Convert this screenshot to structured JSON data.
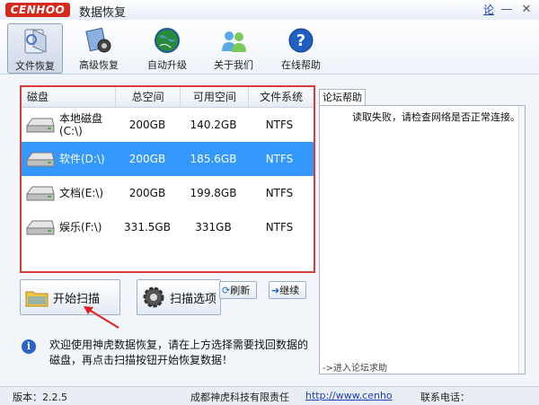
{
  "app": {
    "logo_text": "CENHOO",
    "title": "数据恢复",
    "help_link": "论"
  },
  "toolbar": {
    "items": [
      {
        "label": "文件恢复",
        "icon": "file-recovery-icon",
        "active": true
      },
      {
        "label": "高级恢复",
        "icon": "advanced-recovery-icon",
        "active": false
      },
      {
        "label": "自动升级",
        "icon": "globe-icon",
        "active": false
      },
      {
        "label": "关于我们",
        "icon": "about-users-icon",
        "active": false
      },
      {
        "label": "在线帮助",
        "icon": "help-icon",
        "active": false
      }
    ]
  },
  "drives": {
    "headers": [
      "磁盘",
      "总空间",
      "可用空间",
      "文件系统"
    ],
    "rows": [
      {
        "name": "本地磁盘 (C:\\)",
        "total": "200GB",
        "free": "140.2GB",
        "fs": "NTFS",
        "selected": false
      },
      {
        "name": "软件(D:\\)",
        "total": "200GB",
        "free": "185.6GB",
        "fs": "NTFS",
        "selected": true
      },
      {
        "name": "文档(E:\\)",
        "total": "200GB",
        "free": "199.8GB",
        "fs": "NTFS",
        "selected": false
      },
      {
        "name": "娱乐(F:\\)",
        "total": "331.5GB",
        "free": "331GB",
        "fs": "NTFS",
        "selected": false
      }
    ]
  },
  "actions": {
    "scan": "开始扫描",
    "options": "扫描选项",
    "refresh": "刷新",
    "continue": "继续"
  },
  "info": {
    "text": "欢迎使用神虎数据恢复，请在上方选择需要找回数据的磁盘，再点击扫描按钮开始恢复数据！"
  },
  "forum": {
    "tab": "论坛帮助",
    "message": "读取失败，请检查网络是否正常连接。",
    "link": "->进入论坛求助"
  },
  "status": {
    "version": "版本：2.2.5",
    "company": "成都神虎科技有限责任",
    "url": "http://www.cenho",
    "contact": "联系电话："
  },
  "colors": {
    "selection": "#3399ff",
    "highlight_border": "#d93a3a",
    "logo_red": "#d62a1d",
    "link_blue": "#1a3fb0"
  }
}
